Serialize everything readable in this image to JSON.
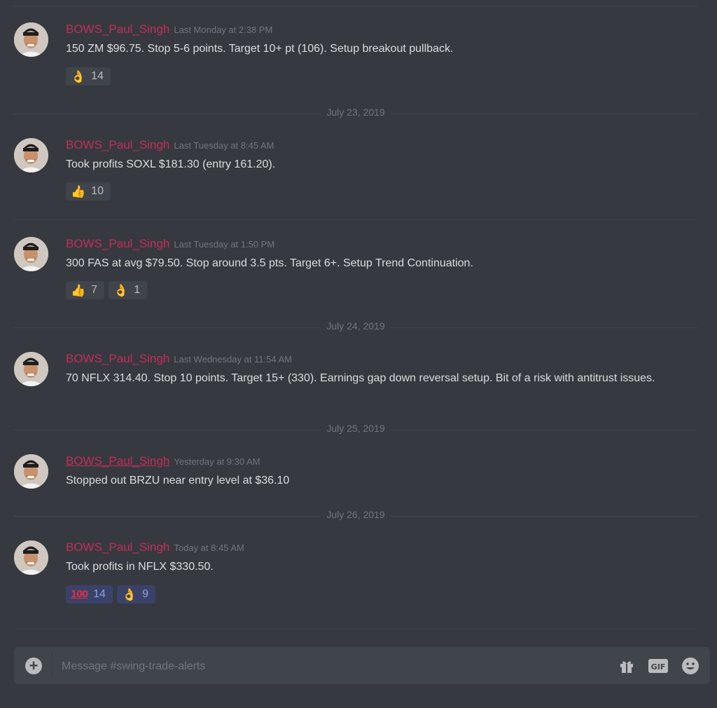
{
  "channel": {
    "composer_placeholder": "Message #swing-trade-alerts"
  },
  "messages": [
    {
      "author": "BOWS_Paul_Singh",
      "timestamp": "Last Monday at 2:38 PM",
      "text": "150 ZM $96.75. Stop 5-6 points. Target 10+ pt (106). Setup breakout pullback.",
      "reactions": [
        {
          "emoji": "ok-hand",
          "count": "14"
        }
      ]
    },
    {
      "author": "BOWS_Paul_Singh",
      "timestamp": "Last Tuesday at 8:45 AM",
      "text": "Took profits SOXL $181.30 (entry 161.20).",
      "reactions": [
        {
          "emoji": "thumbs-up",
          "count": "10"
        }
      ]
    },
    {
      "author": "BOWS_Paul_Singh",
      "timestamp": "Last Tuesday at 1:50 PM",
      "text": "300 FAS at avg $79.50. Stop around 3.5 pts. Target 6+. Setup Trend Continuation.",
      "reactions": [
        {
          "emoji": "thumbs-up",
          "count": "7"
        },
        {
          "emoji": "ok-hand",
          "count": "1"
        }
      ]
    },
    {
      "author": "BOWS_Paul_Singh",
      "timestamp": "Last Wednesday at 11:54 AM",
      "text": "70 NFLX 314.40. Stop 10 points. Target 15+ (330). Earnings gap down reversal setup. Bit of a risk with antitrust issues."
    },
    {
      "author": "BOWS_Paul_Singh",
      "timestamp": "Yesterday at 9:30 AM",
      "text": "Stopped out BRZU near entry level at $36.10"
    },
    {
      "author": "BOWS_Paul_Singh",
      "timestamp": "Today at 8:45 AM",
      "text": "Took profits in NFLX $330.50.",
      "reactions": [
        {
          "emoji": "100",
          "count": "14"
        },
        {
          "emoji": "ok-hand",
          "count": "9"
        }
      ]
    }
  ],
  "date_separators": [
    "July 23, 2019",
    "July 24, 2019",
    "July 25, 2019",
    "July 26, 2019"
  ],
  "colors": {
    "background": "#36393f",
    "author": "#c42e5a",
    "timestamp": "#72767d",
    "reaction_bg": "#40444b",
    "reaction_me_bg": "#3b426a"
  }
}
